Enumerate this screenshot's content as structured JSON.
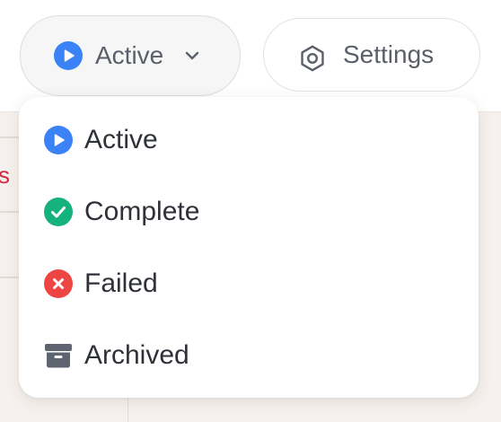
{
  "toolbar": {
    "status_button": {
      "label": "Active",
      "icon": "play-circle-icon",
      "color": "#3b82f6"
    },
    "settings_button": {
      "label": "Settings",
      "icon": "hexagon-gear-icon"
    }
  },
  "background": {
    "partial_text": "s"
  },
  "status_menu": {
    "items": [
      {
        "label": "Active",
        "icon": "play-circle-icon",
        "color": "#3b82f6"
      },
      {
        "label": "Complete",
        "icon": "check-circle-icon",
        "color": "#16b27d"
      },
      {
        "label": "Failed",
        "icon": "x-circle-icon",
        "color": "#ef4444"
      },
      {
        "label": "Archived",
        "icon": "archive-box-icon",
        "color": "#5f6471"
      }
    ]
  },
  "colors": {
    "page_bg": "#f6f1ee",
    "text": "#2f3138",
    "muted_text": "#5b5f69",
    "alert_red": "#d22b41"
  }
}
